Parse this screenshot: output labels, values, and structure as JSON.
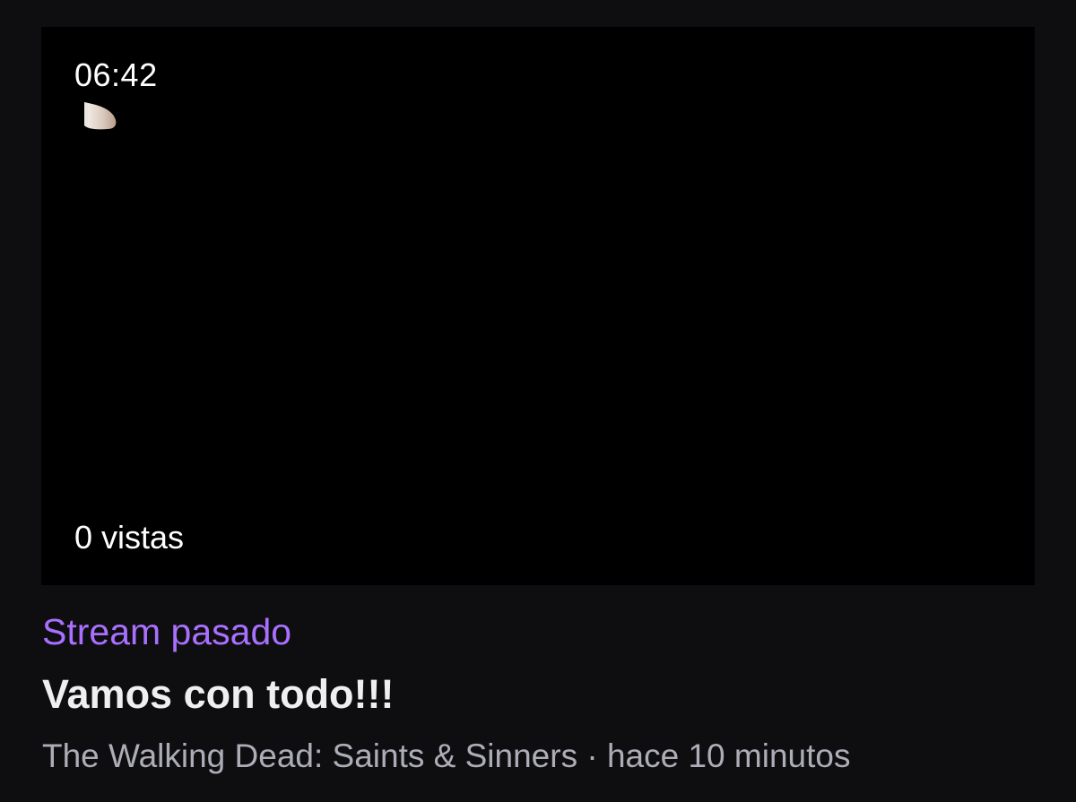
{
  "video": {
    "duration": "06:42",
    "views": "0 vistas",
    "category_label": "Stream pasado",
    "title": "Vamos con todo!!!",
    "game": "The Walking Dead: Saints & Sinners",
    "separator": " · ",
    "time_ago": "hace 10 minutos"
  },
  "colors": {
    "background": "#0e0e10",
    "thumbnail": "#000000",
    "accent": "#a970ff",
    "title": "#efeff1",
    "meta": "#adadb8"
  }
}
